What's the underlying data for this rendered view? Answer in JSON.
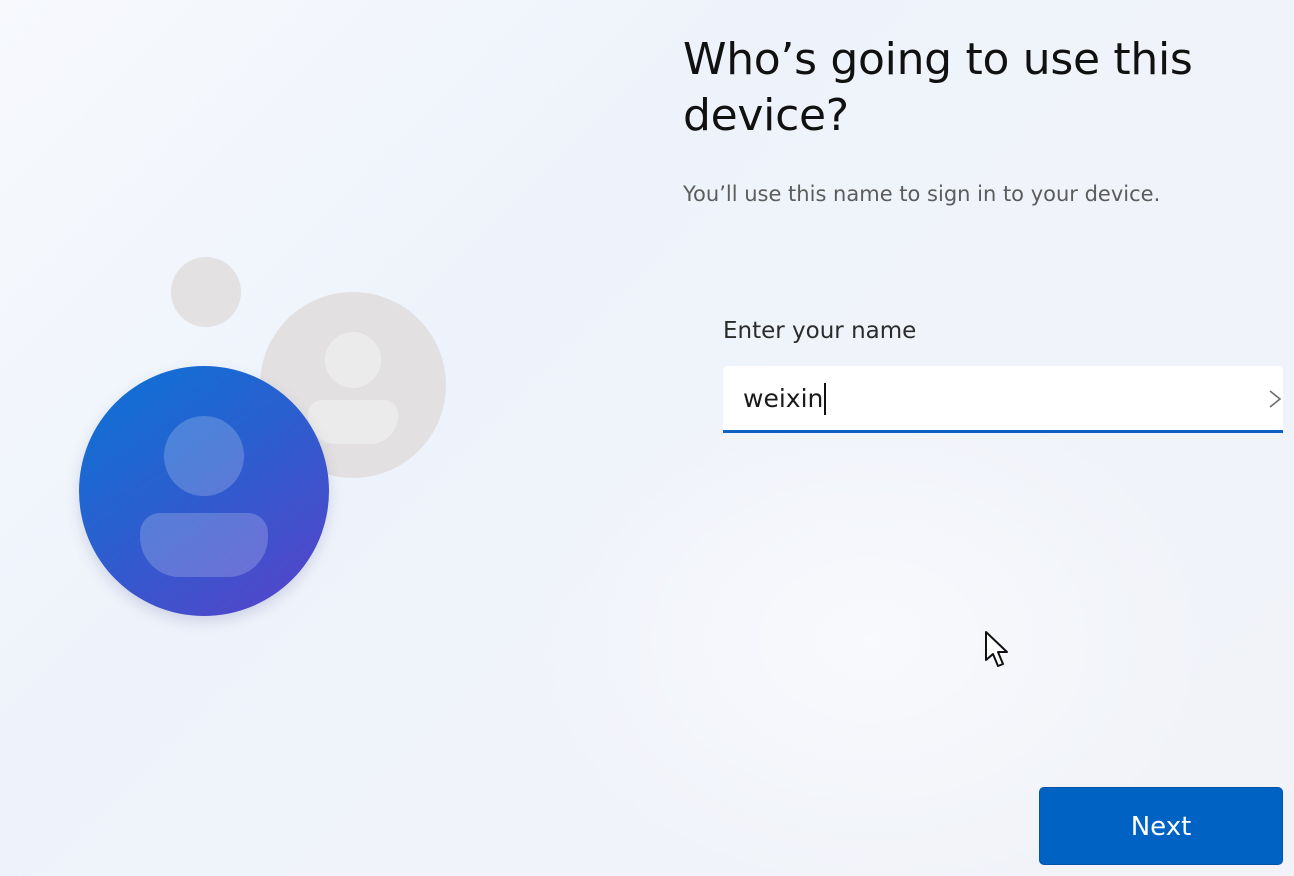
{
  "page": {
    "title": "Who’s going to use this device?",
    "subtitle": "You’ll use this name to sign in to your device."
  },
  "name_field": {
    "label": "Enter your name",
    "value": "weixin"
  },
  "actions": {
    "next_label": "Next"
  },
  "colors": {
    "accent": "#0063c4",
    "avatar_gradient_start": "#0a74d6",
    "avatar_gradient_end": "#5a41c9",
    "avatar_gray": "#e2e0e0"
  },
  "icons": {
    "user_avatar": "person-icon",
    "input_action": "chevron-right-icon",
    "pointer": "mouse-pointer-icon"
  }
}
